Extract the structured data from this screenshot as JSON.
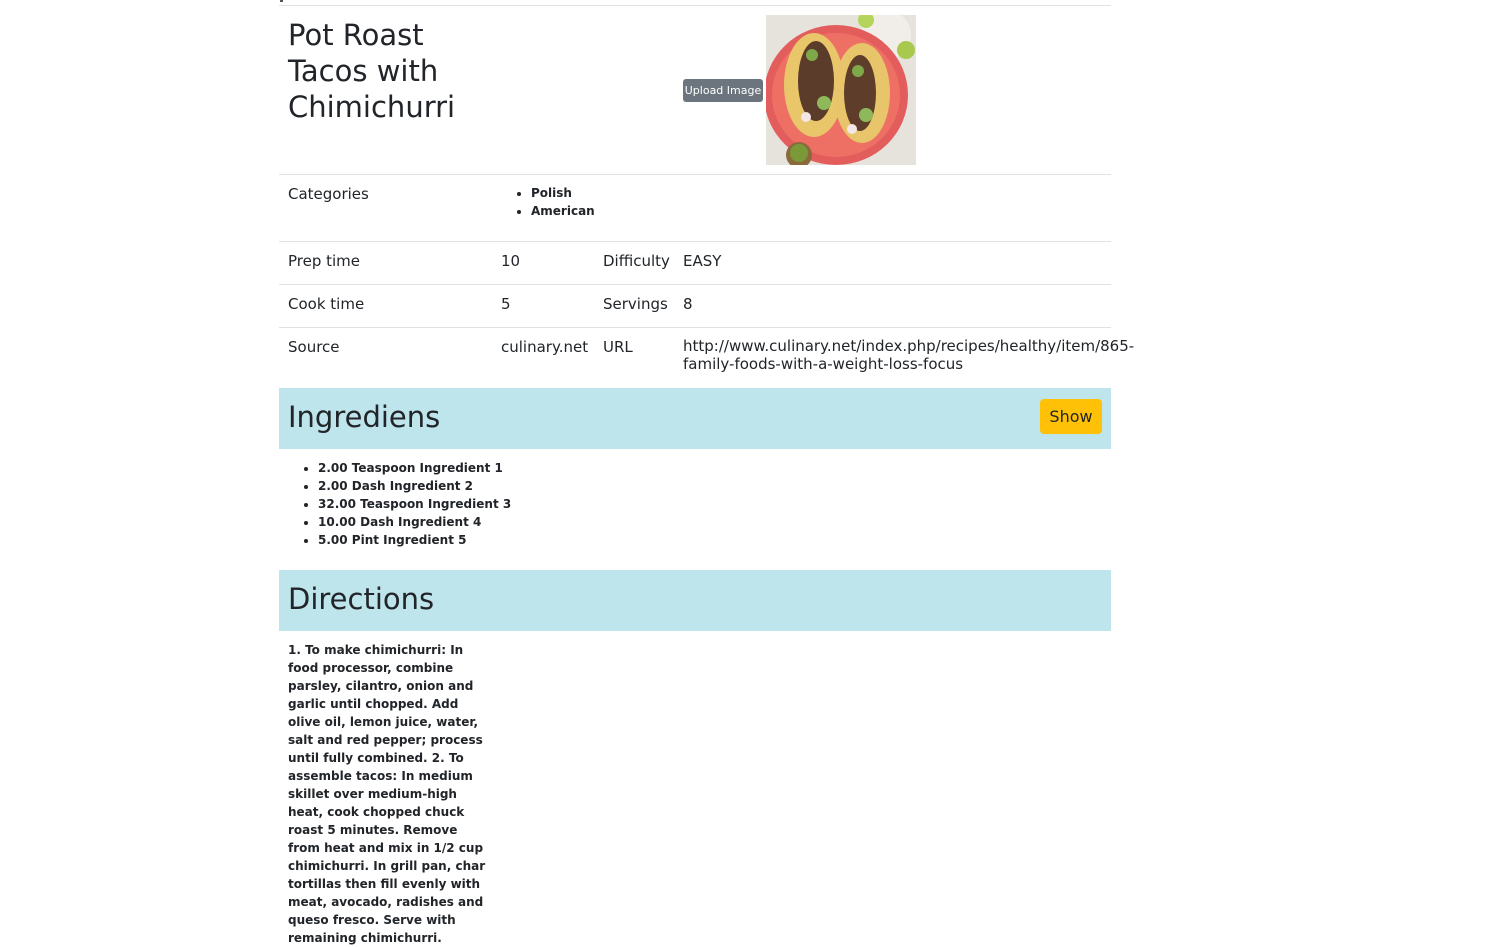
{
  "recipe": {
    "title": "Pot Roast Tacos with Chimichurri",
    "upload_label": "Upload Image"
  },
  "details": {
    "categories_label": "Categories",
    "categories": [
      "Polish",
      "American"
    ],
    "prep_time_label": "Prep time",
    "prep_time": "10",
    "difficulty_label": "Difficulty",
    "difficulty": "EASY",
    "cook_time_label": "Cook time",
    "cook_time": "5",
    "servings_label": "Servings",
    "servings": "8",
    "source_label": "Source",
    "source": "culinary.net",
    "url_label": "URL",
    "url": "http://www.culinary.net/index.php/recipes/healthy/item/865-family-foods-with-a-weight-loss-focus"
  },
  "ingredients": {
    "heading": "Ingrediens",
    "show_label": "Show",
    "items": [
      "2.00 Teaspoon Ingredient 1",
      "2.00 Dash Ingredient 2",
      "32.00 Teaspoon Ingredient 3",
      "10.00 Dash Ingredient 4",
      "5.00 Pint Ingredient 5"
    ]
  },
  "directions": {
    "heading": "Directions",
    "text": "1. To make chimichurri: In food processor, combine parsley, cilantro, onion and garlic until chopped. Add olive oil, lemon juice, water, salt and red pepper; process until fully combined. 2. To assemble tacos: In medium skillet over medium-high heat, cook chopped chuck roast 5 minutes. Remove from heat and mix in 1/2 cup chimichurri. In grill pan, char tortillas then fill evenly with meat, avocado, radishes and queso fresco. Serve with remaining chimichurri."
  },
  "colors": {
    "band": "#bee5eb",
    "show_button": "#ffc107",
    "upload_button": "#6c757d"
  }
}
